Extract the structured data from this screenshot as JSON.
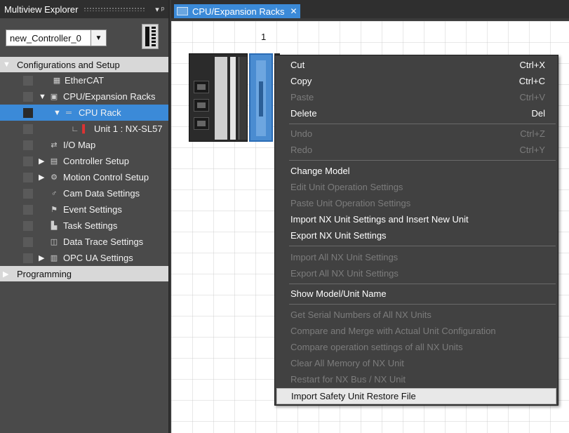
{
  "explorer": {
    "title": "Multiview Explorer",
    "pin_label": "▾ ᵖ",
    "controller": "new_Controller_0",
    "tree": [
      {
        "label": "Configurations and Setup",
        "type": "section"
      },
      {
        "label": "EtherCAT",
        "icon": "ethercat-icon"
      },
      {
        "label": "CPU/Expansion Racks",
        "icon": "rack-icon"
      },
      {
        "label": "CPU Rack",
        "icon": "cpu-rack-icon"
      },
      {
        "label": "Unit 1 : NX-SL57",
        "icon": "unit-icon"
      },
      {
        "label": "I/O Map",
        "icon": "io-map-icon"
      },
      {
        "label": "Controller Setup",
        "icon": "controller-setup-icon"
      },
      {
        "label": "Motion Control Setup",
        "icon": "gear-icon"
      },
      {
        "label": "Cam Data Settings",
        "icon": "cam-icon"
      },
      {
        "label": "Event Settings",
        "icon": "flag-icon"
      },
      {
        "label": "Task Settings",
        "icon": "task-icon"
      },
      {
        "label": "Data Trace Settings",
        "icon": "trace-icon"
      },
      {
        "label": "OPC UA Settings",
        "icon": "opcua-icon"
      },
      {
        "label": "Programming",
        "type": "section"
      }
    ]
  },
  "tab": {
    "label": "CPU/Expansion Racks",
    "close": "✕"
  },
  "canvas": {
    "slot_number": "1"
  },
  "context_menu": {
    "items": [
      {
        "label": "Cut",
        "shortcut": "Ctrl+X",
        "enabled": true
      },
      {
        "label": "Copy",
        "shortcut": "Ctrl+C",
        "enabled": true
      },
      {
        "label": "Paste",
        "shortcut": "Ctrl+V",
        "enabled": false
      },
      {
        "label": "Delete",
        "shortcut": "Del",
        "enabled": true
      },
      {
        "label": "Undo",
        "shortcut": "Ctrl+Z",
        "enabled": false
      },
      {
        "label": "Redo",
        "shortcut": "Ctrl+Y",
        "enabled": false
      },
      {
        "label": "Change Model",
        "shortcut": "",
        "enabled": true
      },
      {
        "label": "Edit Unit Operation Settings",
        "shortcut": "",
        "enabled": false
      },
      {
        "label": "Paste Unit Operation Settings",
        "shortcut": "",
        "enabled": false
      },
      {
        "label": "Import NX Unit Settings and Insert New Unit",
        "shortcut": "",
        "enabled": true
      },
      {
        "label": "Export NX Unit Settings",
        "shortcut": "",
        "enabled": true
      },
      {
        "label": "Import All NX Unit Settings",
        "shortcut": "",
        "enabled": false
      },
      {
        "label": "Export All NX Unit Settings",
        "shortcut": "",
        "enabled": false
      },
      {
        "label": "Show Model/Unit Name",
        "shortcut": "",
        "enabled": true
      },
      {
        "label": "Get Serial Numbers of All NX Units",
        "shortcut": "",
        "enabled": false
      },
      {
        "label": "Compare and Merge with Actual Unit Configuration",
        "shortcut": "",
        "enabled": false
      },
      {
        "label": "Compare operation settings of all NX Units",
        "shortcut": "",
        "enabled": false
      },
      {
        "label": "Clear All Memory of NX Unit",
        "shortcut": "",
        "enabled": false
      },
      {
        "label": "Restart for NX Bus / NX Unit",
        "shortcut": "",
        "enabled": false
      },
      {
        "label": "Import Safety Unit Restore File",
        "shortcut": "",
        "enabled": true,
        "highlighted": true
      }
    ]
  },
  "colors": {
    "selection": "#3b8ad8",
    "panel": "#4a4a4a",
    "menu": "#414141",
    "disabled_text": "#7c7c7c"
  }
}
